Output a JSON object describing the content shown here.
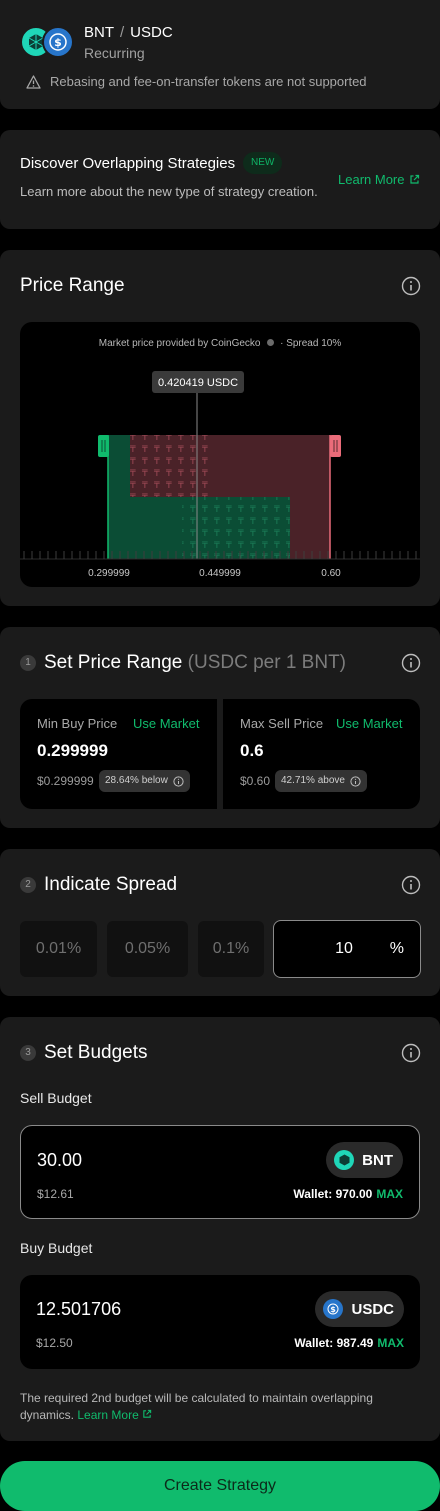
{
  "header": {
    "base_token": "BNT",
    "separator": "/",
    "quote_token": "USDC",
    "strategy_type": "Recurring",
    "warning": "Rebasing and fee-on-transfer tokens are not supported"
  },
  "discover": {
    "title": "Discover Overlapping Strategies",
    "badge": "NEW",
    "subtitle": "Learn more about the new type of strategy creation.",
    "link": "Learn More"
  },
  "price_range": {
    "title": "Price Range",
    "caption": "Market price provided by CoinGecko",
    "spread_caption": "Spread 10%",
    "market_label": "0.420419 USDC",
    "ticks": [
      "0.299999",
      "0.449999",
      "0.60"
    ],
    "min": 0.299999,
    "max": 0.6,
    "market": 0.420419
  },
  "set_price_range": {
    "step": "1",
    "title": "Set Price Range",
    "suffix": "(USDC per 1 BNT)",
    "min_buy": {
      "label": "Min Buy Price",
      "use_market": "Use Market",
      "value": "0.299999",
      "usd": "$0.299999",
      "pct": "28.64% below"
    },
    "max_sell": {
      "label": "Max Sell Price",
      "use_market": "Use Market",
      "value": "0.6",
      "usd": "$0.60",
      "pct": "42.71% above"
    }
  },
  "spread": {
    "step": "2",
    "title": "Indicate Spread",
    "options": [
      "0.01%",
      "0.05%",
      "0.1%"
    ],
    "custom_value": "10",
    "unit": "%"
  },
  "budgets": {
    "step": "3",
    "title": "Set Budgets",
    "sell": {
      "label": "Sell Budget",
      "value": "30.00",
      "usd": "$12.61",
      "token": "BNT",
      "wallet": "Wallet: 970.00",
      "max": "MAX"
    },
    "buy": {
      "label": "Buy Budget",
      "value": "12.501706",
      "usd": "$12.50",
      "token": "USDC",
      "wallet": "Wallet: 987.49",
      "max": "MAX"
    },
    "note": "The required 2nd budget will be calculated to maintain overlapping dynamics.",
    "note_link": "Learn More"
  },
  "cta": "Create Strategy",
  "colors": {
    "accent": "#10bb6d",
    "buy": "#0b4d35",
    "sell": "#5b2b31",
    "sell_handle": "#ea6c7a",
    "buy_handle": "#10bb6d"
  }
}
